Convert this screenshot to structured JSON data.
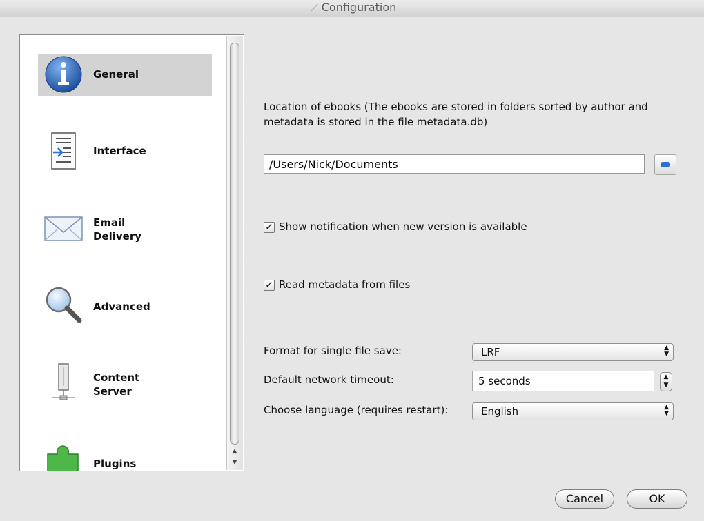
{
  "window": {
    "title": "Configuration",
    "title_icon": "wand-icon"
  },
  "sidebar": {
    "items": [
      {
        "label_line1": "General",
        "label_line2": "",
        "icon": "info-icon",
        "selected": true
      },
      {
        "label_line1": "Interface",
        "label_line2": "",
        "icon": "interface-document-icon",
        "selected": false
      },
      {
        "label_line1": "Email",
        "label_line2": "Delivery",
        "icon": "envelope-icon",
        "selected": false
      },
      {
        "label_line1": "Advanced",
        "label_line2": "",
        "icon": "magnifier-icon",
        "selected": false
      },
      {
        "label_line1": "Content",
        "label_line2": "Server",
        "icon": "server-icon",
        "selected": false
      },
      {
        "label_line1": "Plugins",
        "label_line2": "",
        "icon": "puzzle-piece-icon",
        "selected": false
      }
    ]
  },
  "general": {
    "location_description": "Location of ebooks (The ebooks are stored in folders sorted by author and metadata is stored in the file metadata.db)",
    "location_value": "/Users/Nick/Documents",
    "show_notification": {
      "label": "Show notification when new version is available",
      "checked": true
    },
    "read_metadata": {
      "label": "Read metadata from files",
      "checked": true
    },
    "format_label": "Format for single file save:",
    "format_value": "LRF",
    "timeout_label": "Default network timeout:",
    "timeout_value": "5 seconds",
    "language_label": "Choose language (requires restart):",
    "language_value": "English"
  },
  "footer": {
    "cancel_label": "Cancel",
    "ok_label": "OK"
  },
  "colors": {
    "selection": "#d3d3d3",
    "accent": "#2d6fd6",
    "window_bg": "#e6e6e6"
  }
}
